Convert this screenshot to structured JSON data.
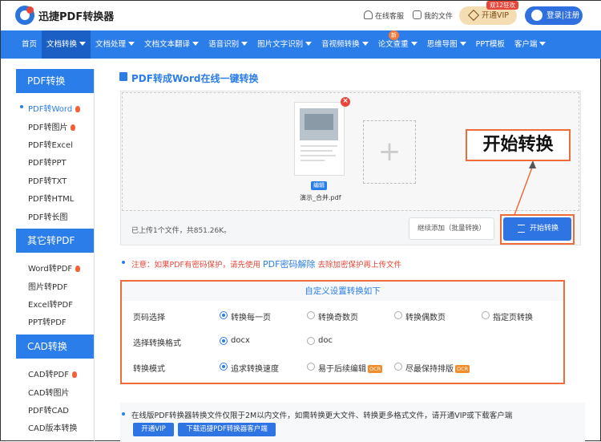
{
  "header": {
    "brand": "迅捷PDF转换器",
    "service": "在线客服",
    "my_files": "我的文件",
    "vip": "开通VIP",
    "promo": "双12狂欢",
    "login": "登录|注册"
  },
  "nav": {
    "items": [
      "首页",
      "文档转换",
      "文档处理",
      "文档文本翻译",
      "语音识别",
      "图片文字识别",
      "音视频转换",
      "论文查重",
      "思维导图",
      "PPT模板",
      "客户端"
    ],
    "new_badge": "新"
  },
  "sidebar": {
    "sections": [
      {
        "title": "PDF转换",
        "items": [
          "PDF转Word",
          "PDF转图片",
          "PDF转Excel",
          "PDF转PPT",
          "PDF转TXT",
          "PDF转HTML",
          "PDF转长图"
        ]
      },
      {
        "title": "其它转PDF",
        "items": [
          "Word转PDF",
          "图片转PDF",
          "Excel转PDF",
          "PPT转PDF"
        ]
      },
      {
        "title": "CAD转换",
        "items": [
          "CAD转PDF",
          "CAD转图片",
          "PDF转CAD",
          "CAD版本转换"
        ]
      }
    ]
  },
  "main": {
    "title": "PDF转成Word在线一键转换",
    "file_name": "演示_合并.pdf",
    "edit_label": "编辑",
    "delete_glyph": "×",
    "add_glyph": "+",
    "upload_count": "已上传1个文件，共851.26K。",
    "continue_button": "继续添加（批量转换）",
    "start_button": "开始转换",
    "callout": "开始转换",
    "note_prefix": "注意：如果PDF有密码保护，请先使用",
    "note_link": "PDF密码解除",
    "note_suffix": "去除加密保护再上传文件"
  },
  "settings": {
    "heading": "自定义设置转换如下",
    "rows": [
      {
        "label": "页码选择",
        "options": [
          "转换每一页",
          "转换奇数页",
          "转换偶数页",
          "指定页转换"
        ],
        "selected": 0
      },
      {
        "label": "选择转换格式",
        "options": [
          "docx",
          "doc"
        ],
        "selected": 0
      },
      {
        "label": "转换模式",
        "options": [
          "追求转换速度",
          "易于后续编辑",
          "尽最保持排版"
        ],
        "selected": 0
      }
    ],
    "ocr_badge": "OCR"
  },
  "bottom": {
    "limit_text": "在线版PDF转换器转换文件仅限于2M以内文件，如需转换更大文件、转换更多格式文件，请开通VIP或下载客户端",
    "vip_button": "开通VIP",
    "download_button": "下载迅捷PDF转换器客户端"
  },
  "colors": {
    "accent": "#2b7de9",
    "highlight": "#ef6c3a",
    "warning": "#e8463a"
  }
}
